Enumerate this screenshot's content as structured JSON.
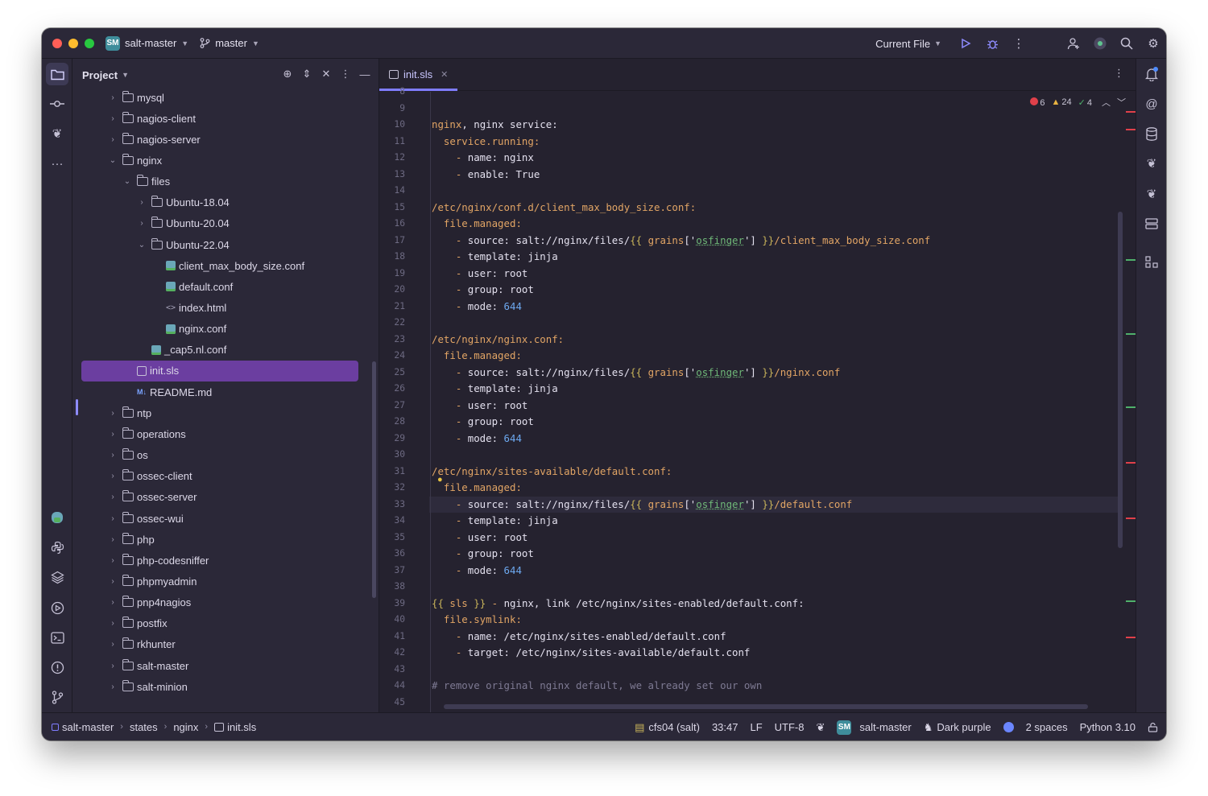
{
  "titlebar": {
    "project_badge": "SM",
    "project_name": "salt-master",
    "branch_name": "master",
    "run_config": "Current File",
    "icons": [
      "run-icon",
      "debug-icon",
      "more-vert-icon",
      "add-user-icon",
      "ai-assistant-icon",
      "search-icon",
      "settings-icon"
    ]
  },
  "project_panel": {
    "title": "Project",
    "tree": [
      {
        "label": "mysql",
        "type": "folder",
        "depth": 0,
        "expanded": false
      },
      {
        "label": "nagios-client",
        "type": "folder",
        "depth": 0,
        "expanded": false
      },
      {
        "label": "nagios-server",
        "type": "folder",
        "depth": 0,
        "expanded": false
      },
      {
        "label": "nginx",
        "type": "folder",
        "depth": 0,
        "expanded": true
      },
      {
        "label": "files",
        "type": "folder",
        "depth": 1,
        "expanded": true
      },
      {
        "label": "Ubuntu-18.04",
        "type": "folder",
        "depth": 2,
        "expanded": false
      },
      {
        "label": "Ubuntu-20.04",
        "type": "folder",
        "depth": 2,
        "expanded": false
      },
      {
        "label": "Ubuntu-22.04",
        "type": "folder",
        "depth": 2,
        "expanded": true
      },
      {
        "label": "client_max_body_size.conf",
        "type": "conf",
        "depth": 3
      },
      {
        "label": "default.conf",
        "type": "conf",
        "depth": 3
      },
      {
        "label": "index.html",
        "type": "html",
        "depth": 3
      },
      {
        "label": "nginx.conf",
        "type": "conf",
        "depth": 3
      },
      {
        "label": "_cap5.nl.conf",
        "type": "conf",
        "depth": 2
      },
      {
        "label": "init.sls",
        "type": "sls",
        "depth": 1,
        "selected": true
      },
      {
        "label": "README.md",
        "type": "md",
        "depth": 1
      },
      {
        "label": "ntp",
        "type": "folder",
        "depth": 0,
        "expanded": false
      },
      {
        "label": "operations",
        "type": "folder",
        "depth": 0,
        "expanded": false
      },
      {
        "label": "os",
        "type": "folder",
        "depth": 0,
        "expanded": false
      },
      {
        "label": "ossec-client",
        "type": "folder",
        "depth": 0,
        "expanded": false
      },
      {
        "label": "ossec-server",
        "type": "folder",
        "depth": 0,
        "expanded": false
      },
      {
        "label": "ossec-wui",
        "type": "folder",
        "depth": 0,
        "expanded": false
      },
      {
        "label": "php",
        "type": "folder",
        "depth": 0,
        "expanded": false
      },
      {
        "label": "php-codesniffer",
        "type": "folder",
        "depth": 0,
        "expanded": false
      },
      {
        "label": "phpmyadmin",
        "type": "folder",
        "depth": 0,
        "expanded": false
      },
      {
        "label": "pnp4nagios",
        "type": "folder",
        "depth": 0,
        "expanded": false
      },
      {
        "label": "postfix",
        "type": "folder",
        "depth": 0,
        "expanded": false
      },
      {
        "label": "rkhunter",
        "type": "folder",
        "depth": 0,
        "expanded": false
      },
      {
        "label": "salt-master",
        "type": "folder",
        "depth": 0,
        "expanded": false
      },
      {
        "label": "salt-minion",
        "type": "folder",
        "depth": 0,
        "expanded": false
      }
    ]
  },
  "editor": {
    "tab_label": "init.sls",
    "inspections": {
      "errors": "6",
      "warnings": "24",
      "ok": "4"
    },
    "first_line_number": 8,
    "lines": [
      [],
      [],
      [
        [
          "k",
          "nginx"
        ],
        [
          "p",
          ", nginx service:"
        ]
      ],
      [
        [
          "p",
          "  "
        ],
        [
          "k",
          "service.running:"
        ]
      ],
      [
        [
          "p",
          "    "
        ],
        [
          "d",
          "- "
        ],
        [
          "p",
          "name: nginx"
        ]
      ],
      [
        [
          "p",
          "    "
        ],
        [
          "d",
          "- "
        ],
        [
          "p",
          "enable: True"
        ]
      ],
      [],
      [
        [
          "k",
          "/etc/nginx/conf.d/client_max_body_size.conf:"
        ]
      ],
      [
        [
          "p",
          "  "
        ],
        [
          "k",
          "file.managed:"
        ]
      ],
      [
        [
          "p",
          "    "
        ],
        [
          "d",
          "- "
        ],
        [
          "p",
          "source: salt://nginx/files/"
        ],
        [
          "t",
          "{{"
        ],
        [
          "p",
          " "
        ],
        [
          "r",
          "grains"
        ],
        [
          "p",
          "['"
        ],
        [
          "s",
          "osfinger"
        ],
        [
          "p",
          "'] "
        ],
        [
          "t",
          "}}"
        ],
        [
          "r",
          "/client_max_body_size.conf"
        ]
      ],
      [
        [
          "p",
          "    "
        ],
        [
          "d",
          "- "
        ],
        [
          "p",
          "template: jinja"
        ]
      ],
      [
        [
          "p",
          "    "
        ],
        [
          "d",
          "- "
        ],
        [
          "p",
          "user: root"
        ]
      ],
      [
        [
          "p",
          "    "
        ],
        [
          "d",
          "- "
        ],
        [
          "p",
          "group: root"
        ]
      ],
      [
        [
          "p",
          "    "
        ],
        [
          "d",
          "- "
        ],
        [
          "p",
          "mode: "
        ],
        [
          "n",
          "644"
        ]
      ],
      [],
      [
        [
          "k",
          "/etc/nginx/nginx.conf:"
        ]
      ],
      [
        [
          "p",
          "  "
        ],
        [
          "k",
          "file.managed:"
        ]
      ],
      [
        [
          "p",
          "    "
        ],
        [
          "d",
          "- "
        ],
        [
          "p",
          "source: salt://nginx/files/"
        ],
        [
          "t",
          "{{"
        ],
        [
          "p",
          " "
        ],
        [
          "r",
          "grains"
        ],
        [
          "p",
          "['"
        ],
        [
          "s",
          "osfinger"
        ],
        [
          "p",
          "'] "
        ],
        [
          "t",
          "}}"
        ],
        [
          "r",
          "/nginx.conf"
        ]
      ],
      [
        [
          "p",
          "    "
        ],
        [
          "d",
          "- "
        ],
        [
          "p",
          "template: jinja"
        ]
      ],
      [
        [
          "p",
          "    "
        ],
        [
          "d",
          "- "
        ],
        [
          "p",
          "user: root"
        ]
      ],
      [
        [
          "p",
          "    "
        ],
        [
          "d",
          "- "
        ],
        [
          "p",
          "group: root"
        ]
      ],
      [
        [
          "p",
          "    "
        ],
        [
          "d",
          "- "
        ],
        [
          "p",
          "mode: "
        ],
        [
          "n",
          "644"
        ]
      ],
      [],
      [
        [
          "k",
          "/etc/nginx/sites-available/default.conf:"
        ]
      ],
      [
        [
          "p",
          "  "
        ],
        [
          "k",
          "file.managed:"
        ]
      ],
      [
        [
          "p",
          "    "
        ],
        [
          "d",
          "- "
        ],
        [
          "p",
          "source: salt://nginx/files/"
        ],
        [
          "t",
          "{{"
        ],
        [
          "p",
          " "
        ],
        [
          "r",
          "grains"
        ],
        [
          "p",
          "['"
        ],
        [
          "s",
          "osfinger"
        ],
        [
          "p",
          "'] "
        ],
        [
          "t",
          "}}"
        ],
        [
          "r",
          "/default.conf"
        ]
      ],
      [
        [
          "p",
          "    "
        ],
        [
          "d",
          "- "
        ],
        [
          "p",
          "template: jinja"
        ]
      ],
      [
        [
          "p",
          "    "
        ],
        [
          "d",
          "- "
        ],
        [
          "p",
          "user: root"
        ]
      ],
      [
        [
          "p",
          "    "
        ],
        [
          "d",
          "- "
        ],
        [
          "p",
          "group: root"
        ]
      ],
      [
        [
          "p",
          "    "
        ],
        [
          "d",
          "- "
        ],
        [
          "p",
          "mode: "
        ],
        [
          "n",
          "644"
        ]
      ],
      [],
      [
        [
          "t",
          "{{"
        ],
        [
          "p",
          " "
        ],
        [
          "r",
          "sls"
        ],
        [
          "p",
          " "
        ],
        [
          "t",
          "}}"
        ],
        [
          "p",
          " "
        ],
        [
          "d",
          "-"
        ],
        [
          "p",
          " nginx, link /etc/nginx/sites-enabled/default.conf:"
        ]
      ],
      [
        [
          "p",
          "  "
        ],
        [
          "k",
          "file.symlink:"
        ]
      ],
      [
        [
          "p",
          "    "
        ],
        [
          "d",
          "- "
        ],
        [
          "p",
          "name: /etc/nginx/sites-enabled/default.conf"
        ]
      ],
      [
        [
          "p",
          "    "
        ],
        [
          "d",
          "- "
        ],
        [
          "p",
          "target: /etc/nginx/sites-available/default.conf"
        ]
      ],
      [],
      [
        [
          "c",
          "# remove original nginx default, we already set our own"
        ]
      ],
      []
    ]
  },
  "statusbar": {
    "breadcrumbs": [
      "salt-master",
      "states",
      "nginx",
      "init.sls"
    ],
    "interpreter_host": "cfs04 (salt)",
    "cursor_position": "33:47",
    "line_separator": "LF",
    "encoding": "UTF-8",
    "project_badge": "SM",
    "project_name": "salt-master",
    "theme": "Dark purple",
    "indent": "2 spaces",
    "python_version": "Python 3.10"
  },
  "colors": {
    "accent": "#7f7dff",
    "selection": "#6b3ea0",
    "error": "#e0404a",
    "warning": "#e8b341",
    "ok": "#4fb06b"
  }
}
